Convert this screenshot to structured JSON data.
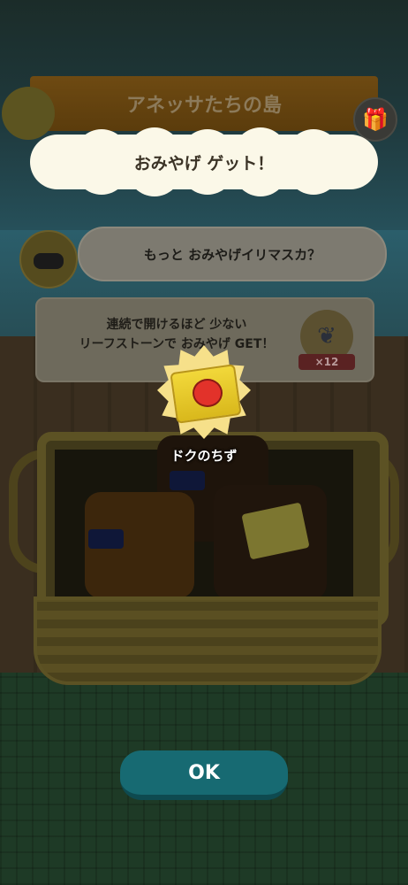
{
  "header": {
    "island_title": "アネッサたちの島",
    "gift_icon": "gift-icon"
  },
  "dialog": {
    "title": "おみやげ ゲット！",
    "npc_message": "もっと おみやげイリマスカ？",
    "info_line1": "連続で開けるほど 少ない",
    "info_line2": "リーフストーンで おみやげ GET！",
    "leaf_stone_count": "×12",
    "reward_name": "ドクのちず",
    "ok_label": "OK"
  },
  "colors": {
    "ok_button": "#176a72",
    "cloud": "#fbf8e8",
    "reward_badge": "#f6e08a"
  }
}
